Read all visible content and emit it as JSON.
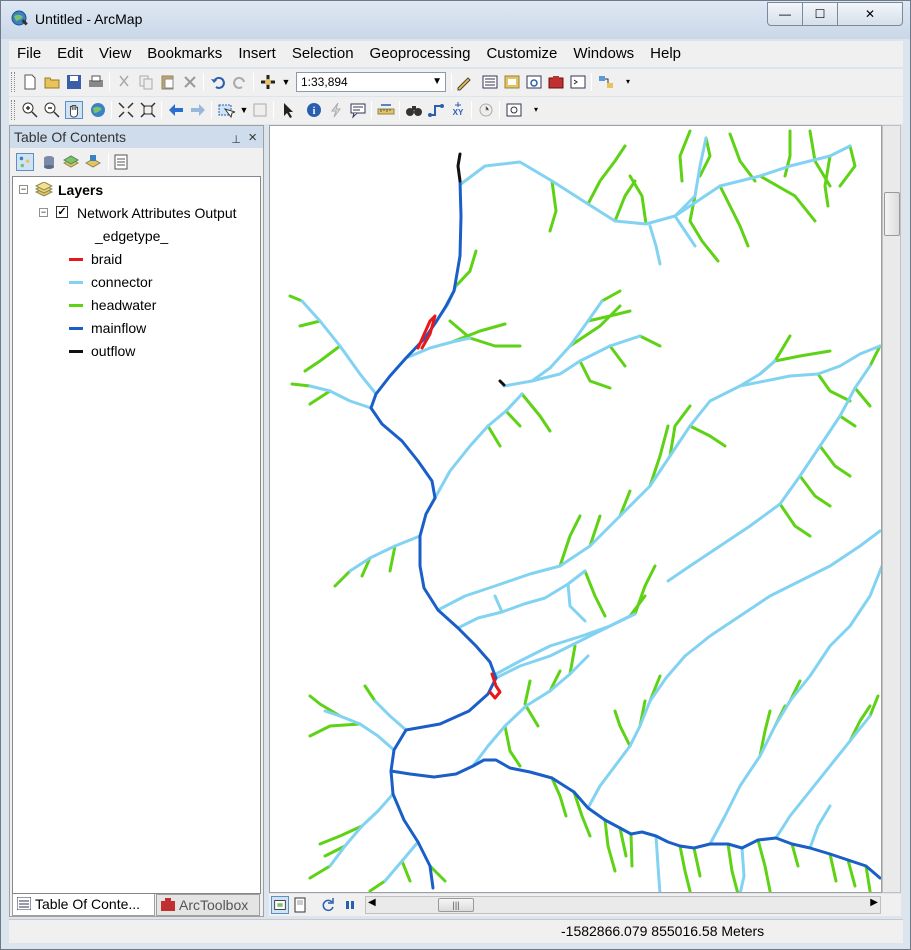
{
  "window": {
    "title": "Untitled - ArcMap",
    "minimize_symbol": "—",
    "maximize_symbol": "☐",
    "close_symbol": "✕"
  },
  "menu": [
    "File",
    "Edit",
    "View",
    "Bookmarks",
    "Insert",
    "Selection",
    "Geoprocessing",
    "Customize",
    "Windows",
    "Help"
  ],
  "toolbar": {
    "scale_value": "1:33,894"
  },
  "toc": {
    "title": "Table Of Contents",
    "pin_symbol": "📌",
    "close_symbol": "×",
    "root_label": "Layers",
    "layer_name": "Network Attributes Output",
    "field_name": "_edgetype_",
    "legend": [
      {
        "label": "braid",
        "color": "#e81818"
      },
      {
        "label": "connector",
        "color": "#82d2f2"
      },
      {
        "label": "headwater",
        "color": "#5ed214"
      },
      {
        "label": "mainflow",
        "color": "#1a5ec8"
      },
      {
        "label": "outflow",
        "color": "#111111"
      }
    ],
    "tabs": [
      "Table Of Conte...",
      "ArcToolbox"
    ]
  },
  "status": {
    "coordinates": "-1582866.079  855016.58 Meters"
  },
  "colors": {
    "braid": "#e81818",
    "connector": "#82d2f2",
    "headwater": "#5ed214",
    "mainflow": "#1a5ec8",
    "outflow": "#111111"
  }
}
